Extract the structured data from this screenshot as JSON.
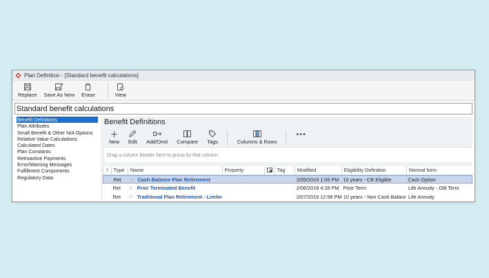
{
  "window": {
    "title": "Plan Definition - [Standard benefit calculations]"
  },
  "toolbar": {
    "replace_label": "Replace",
    "save_as_new_label": "Save As New",
    "erase_label": "Erase",
    "view_label": "View"
  },
  "header": {
    "title": "Standard benefit calculations"
  },
  "sidebar": {
    "items": [
      {
        "label": "Benefit Definitions",
        "selected": true
      },
      {
        "label": "Plan Attributes"
      },
      {
        "label": "Small Benefit & Other N/A Options"
      },
      {
        "label": "Relative Value Calculations"
      },
      {
        "label": "Calculated Dates"
      },
      {
        "label": "Plan Constants"
      },
      {
        "label": "Retroactive Payments"
      },
      {
        "label": "Error/Warning Messages"
      },
      {
        "label": "Fulfillment Components"
      },
      {
        "label": "Regulatory Data"
      }
    ]
  },
  "panel": {
    "title": "Benefit Definitions",
    "tools": {
      "new_label": "New",
      "edit_label": "Edit",
      "add_omit_label": "Add/Omit",
      "compare_label": "Compare",
      "tags_label": "Tags",
      "columns_rows_label": "Columns & Rows",
      "more_label": "•••"
    },
    "group_hint": "Drag a column header here to group by that column."
  },
  "table": {
    "columns": [
      "!",
      "Type",
      "Name",
      "Property",
      "",
      "Tag",
      "Modified",
      "Eligibility Definition",
      "Normal form"
    ],
    "rows": [
      {
        "type": "Ret",
        "name": "Cash Balance Plan Retirement",
        "property": "",
        "tag": "",
        "modified": "2/05/2019  1:06 PM",
        "eligibility": "10 years - CB Eligible",
        "normal_form": "Cash Option",
        "selected": true
      },
      {
        "type": "Ret",
        "name": "Prior Terminated Benefit",
        "property": "",
        "tag": "",
        "modified": "2/06/2019  4:28 PM",
        "eligibility": "Prior Term",
        "normal_form": "Life Annuity - Old Term"
      },
      {
        "type": "Ret",
        "name": "Traditional Plan Retirement - Limited",
        "property": "",
        "tag": "",
        "modified": "2/07/2019 12:56 PM",
        "eligibility": "10 years - Non Cash Balance",
        "normal_form": "Life Annuity"
      }
    ]
  },
  "colors": {
    "accent": "#1a6fd1",
    "selection_row": "#c9d6ec",
    "name_link": "#1f56a6",
    "background": "#d3ecf1"
  }
}
